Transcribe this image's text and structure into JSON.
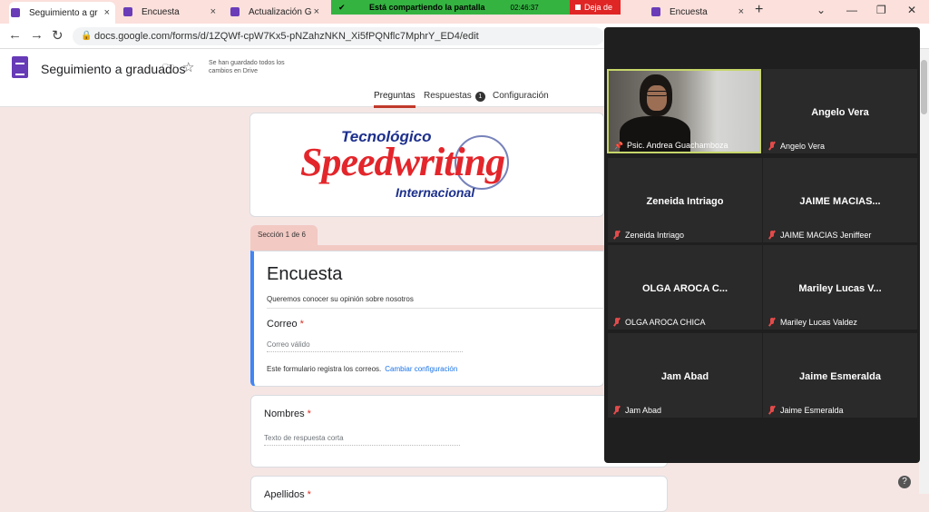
{
  "browser": {
    "tabs": [
      {
        "label": "Seguimiento a gr",
        "active": true
      },
      {
        "label": "Encuesta",
        "active": false
      },
      {
        "label": "Actualización GR",
        "active": false
      },
      {
        "label": "Encuesta",
        "active": false
      }
    ],
    "url": "docs.google.com/forms/d/1ZQWf-cpW7Kx5-pNZahzNKN_Xi5fPQNflc7MphrY_ED4/edit",
    "share_banner": "Está compartiendo la pantalla",
    "share_time": "02:46:37",
    "stop_sharing": "Deja de"
  },
  "form_header": {
    "title": "Seguimiento a graduados",
    "saved_status": "Se han guardado todos los cambios en Drive",
    "tabs": [
      "Preguntas",
      "Respuestas",
      "Configuración"
    ],
    "responses_count": "1"
  },
  "banner": {
    "line1": "Tecnológico",
    "line2": "Speedwriting",
    "line3": "Internacional"
  },
  "section": {
    "label": "Sección 1 de 6",
    "title": "Encuesta",
    "description": "Queremos conocer su opinión sobre nosotros",
    "email_label": "Correo",
    "email_placeholder": "Correo válido",
    "note": "Este formulario registra los correos.",
    "note_link": "Cambiar configuración"
  },
  "questions": [
    {
      "label": "Nombres",
      "placeholder": "Texto de respuesta corta"
    },
    {
      "label": "Apellidos"
    }
  ],
  "meeting": {
    "participants": [
      {
        "big": "",
        "name": "Psic. Andrea Guachamboza",
        "video": true
      },
      {
        "big": "Angelo Vera",
        "name": "Angelo Vera"
      },
      {
        "big": "Zeneida Intriago",
        "name": "Zeneida Intriago"
      },
      {
        "big": "JAIME MACIAS...",
        "name": "JAIME MACIAS Jeniffeer"
      },
      {
        "big": "OLGA AROCA C...",
        "name": "OLGA AROCA CHICA"
      },
      {
        "big": "Mariley Lucas V...",
        "name": "Mariley Lucas Valdez"
      },
      {
        "big": "Jam Abad",
        "name": "Jam Abad"
      },
      {
        "big": "Jaime Esmeralda",
        "name": "Jaime Esmeralda"
      }
    ]
  },
  "icons": {
    "close": "×",
    "new_tab": "+",
    "back": "←",
    "forward": "→",
    "reload": "↻",
    "help": "?"
  }
}
